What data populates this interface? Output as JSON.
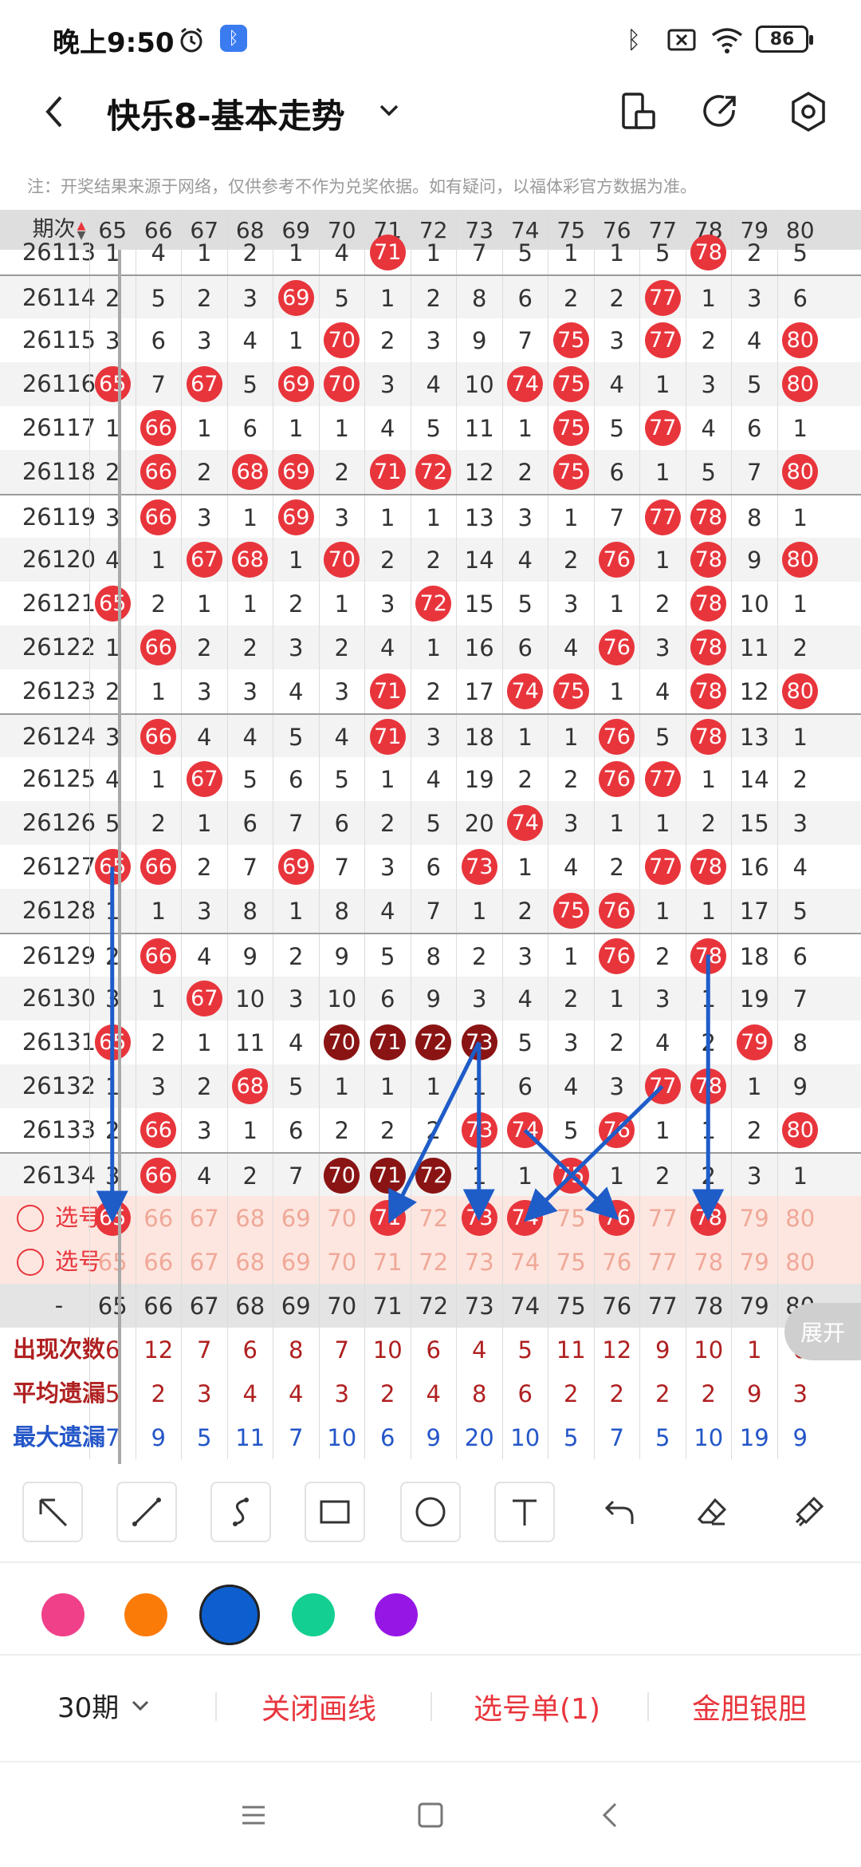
{
  "status_bar": {
    "time": "晚上9:50",
    "battery": "86"
  },
  "header": {
    "title": "快乐8-基本走势"
  },
  "disclaimer": "注：开奖结果来源于网络，仅供参考不作为兑奖依据。如有疑问，以福体彩官方数据为准。",
  "table": {
    "period_label": "期次",
    "columns": [
      "65",
      "66",
      "67",
      "68",
      "69",
      "70",
      "71",
      "72",
      "73",
      "74",
      "75",
      "76",
      "77",
      "78",
      "79",
      "80"
    ],
    "rows": [
      {
        "period": "26113",
        "values": [
          "1",
          "4",
          "1",
          "2",
          "1",
          "4",
          "71",
          "1",
          "7",
          "5",
          "1",
          "1",
          "5",
          "78",
          "2",
          "5"
        ]
      },
      {
        "period": "26114",
        "values": [
          "2",
          "5",
          "2",
          "3",
          "69",
          "5",
          "1",
          "2",
          "8",
          "6",
          "2",
          "2",
          "77",
          "1",
          "3",
          "6"
        ]
      },
      {
        "period": "26115",
        "values": [
          "3",
          "6",
          "3",
          "4",
          "1",
          "70",
          "2",
          "3",
          "9",
          "7",
          "75",
          "3",
          "77",
          "2",
          "4",
          "80"
        ]
      },
      {
        "period": "26116",
        "values": [
          "65",
          "7",
          "67",
          "5",
          "69",
          "70",
          "3",
          "4",
          "10",
          "74",
          "75",
          "4",
          "1",
          "3",
          "5",
          "80"
        ]
      },
      {
        "period": "26117",
        "values": [
          "1",
          "66",
          "1",
          "6",
          "1",
          "1",
          "4",
          "5",
          "11",
          "1",
          "75",
          "5",
          "77",
          "4",
          "6",
          "1"
        ]
      },
      {
        "period": "26118",
        "values": [
          "2",
          "66",
          "2",
          "68",
          "69",
          "2",
          "71",
          "72",
          "12",
          "2",
          "75",
          "6",
          "1",
          "5",
          "7",
          "80"
        ]
      },
      {
        "period": "26119",
        "values": [
          "3",
          "66",
          "3",
          "1",
          "69",
          "3",
          "1",
          "1",
          "13",
          "3",
          "1",
          "7",
          "77",
          "78",
          "8",
          "1"
        ]
      },
      {
        "period": "26120",
        "values": [
          "4",
          "1",
          "67",
          "68",
          "1",
          "70",
          "2",
          "2",
          "14",
          "4",
          "2",
          "76",
          "1",
          "78",
          "9",
          "80"
        ]
      },
      {
        "period": "26121",
        "values": [
          "65",
          "2",
          "1",
          "1",
          "2",
          "1",
          "3",
          "72",
          "15",
          "5",
          "3",
          "1",
          "2",
          "78",
          "10",
          "1"
        ]
      },
      {
        "period": "26122",
        "values": [
          "1",
          "66",
          "2",
          "2",
          "3",
          "2",
          "4",
          "1",
          "16",
          "6",
          "4",
          "76",
          "3",
          "78",
          "11",
          "2"
        ]
      },
      {
        "period": "26123",
        "values": [
          "2",
          "1",
          "3",
          "3",
          "4",
          "3",
          "71",
          "2",
          "17",
          "74",
          "75",
          "1",
          "4",
          "78",
          "12",
          "80"
        ]
      },
      {
        "period": "26124",
        "values": [
          "3",
          "66",
          "4",
          "4",
          "5",
          "4",
          "71",
          "3",
          "18",
          "1",
          "1",
          "76",
          "5",
          "78",
          "13",
          "1"
        ]
      },
      {
        "period": "26125",
        "values": [
          "4",
          "1",
          "67",
          "5",
          "6",
          "5",
          "1",
          "4",
          "19",
          "2",
          "2",
          "76",
          "77",
          "1",
          "14",
          "2"
        ]
      },
      {
        "period": "26126",
        "values": [
          "5",
          "2",
          "1",
          "6",
          "7",
          "6",
          "2",
          "5",
          "20",
          "74",
          "3",
          "1",
          "1",
          "2",
          "15",
          "3"
        ]
      },
      {
        "period": "26127",
        "values": [
          "65",
          "66",
          "2",
          "7",
          "69",
          "7",
          "3",
          "6",
          "73",
          "1",
          "4",
          "2",
          "77",
          "78",
          "16",
          "4"
        ]
      },
      {
        "period": "26128",
        "values": [
          "1",
          "1",
          "3",
          "8",
          "1",
          "8",
          "4",
          "7",
          "1",
          "2",
          "75",
          "76",
          "1",
          "1",
          "17",
          "5"
        ]
      },
      {
        "period": "26129",
        "values": [
          "2",
          "66",
          "4",
          "9",
          "2",
          "9",
          "5",
          "8",
          "2",
          "3",
          "1",
          "76",
          "2",
          "78",
          "18",
          "6"
        ]
      },
      {
        "period": "26130",
        "values": [
          "3",
          "1",
          "67",
          "10",
          "3",
          "10",
          "6",
          "9",
          "3",
          "4",
          "2",
          "1",
          "3",
          "1",
          "19",
          "7"
        ]
      },
      {
        "period": "26131",
        "values": [
          "65",
          "2",
          "1",
          "11",
          "4",
          "70",
          "71",
          "72",
          "73",
          "5",
          "3",
          "2",
          "4",
          "2",
          "79",
          "8"
        ]
      },
      {
        "period": "26132",
        "values": [
          "1",
          "3",
          "2",
          "68",
          "5",
          "1",
          "1",
          "1",
          "1",
          "6",
          "4",
          "3",
          "77",
          "78",
          "1",
          "9"
        ]
      },
      {
        "period": "26133",
        "values": [
          "2",
          "66",
          "3",
          "1",
          "6",
          "2",
          "2",
          "2",
          "73",
          "74",
          "5",
          "76",
          "1",
          "1",
          "2",
          "80"
        ]
      },
      {
        "period": "26134",
        "values": [
          "3",
          "66",
          "4",
          "2",
          "7",
          "70",
          "71",
          "72",
          "1",
          "1",
          "75",
          "1",
          "2",
          "2",
          "3",
          "1"
        ]
      }
    ],
    "select_label": "选号",
    "selected_numbers": [
      "65",
      "71",
      "73",
      "74",
      "76",
      "78"
    ],
    "stats_header_label": "-",
    "stats": [
      {
        "label": "出现次数",
        "values": [
          "6",
          "12",
          "7",
          "6",
          "8",
          "7",
          "10",
          "6",
          "4",
          "5",
          "11",
          "12",
          "9",
          "10",
          "1",
          "6"
        ]
      },
      {
        "label": "平均遗漏",
        "values": [
          "5",
          "2",
          "3",
          "4",
          "4",
          "3",
          "2",
          "4",
          "8",
          "6",
          "2",
          "2",
          "2",
          "2",
          "9",
          "3"
        ]
      },
      {
        "label": "最大遗漏",
        "values": [
          "7",
          "9",
          "5",
          "11",
          "7",
          "10",
          "6",
          "9",
          "20",
          "10",
          "5",
          "7",
          "5",
          "10",
          "19",
          "9"
        ]
      }
    ],
    "expand_label": "展开"
  },
  "tools": [
    "arrow-tool",
    "line-tool",
    "curve-tool",
    "rectangle-tool",
    "circle-tool",
    "text-tool",
    "undo-tool",
    "eraser-tool",
    "clear-tool"
  ],
  "colors": [
    "#f0408a",
    "#fb7b08",
    "#0d5fcf",
    "#14cf92",
    "#9616e6"
  ],
  "bottom_bar": {
    "period": "30期",
    "close_draw": "关闭画线",
    "selection_list": "选号单(1)",
    "golden_ball": "金胆银胆"
  },
  "theme": {
    "accent": "#e8353c",
    "arrow": "#1e5cc8"
  }
}
